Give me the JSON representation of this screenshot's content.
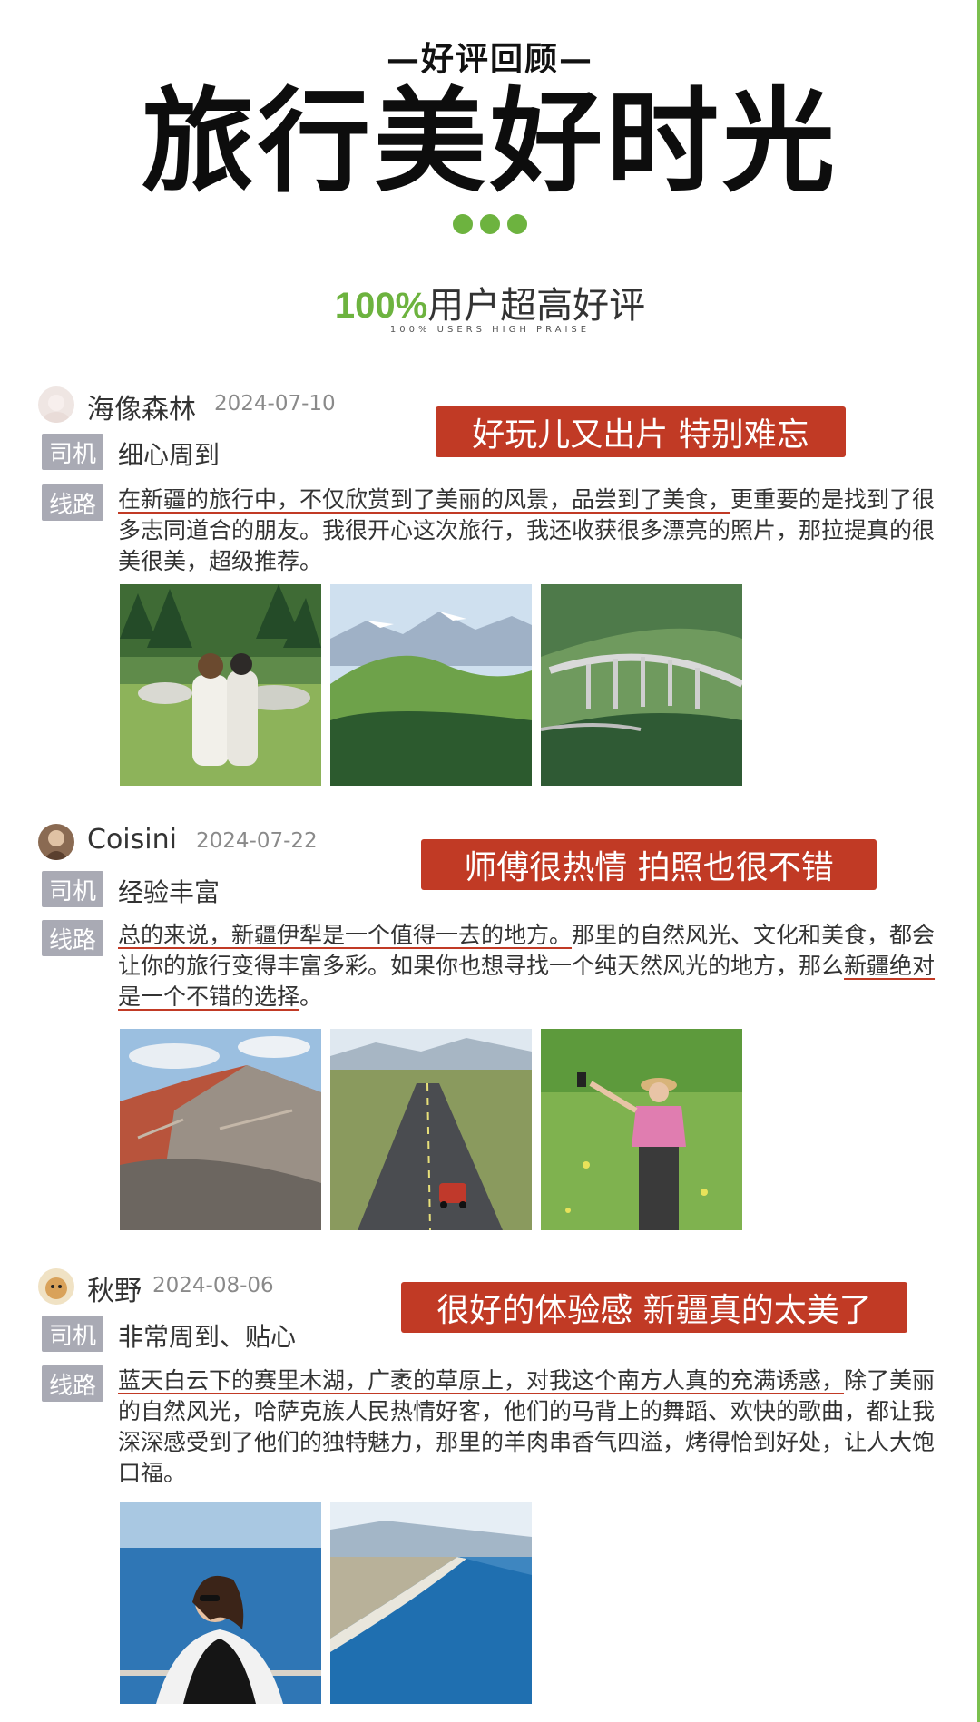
{
  "header": {
    "kicker": "—好评回顾—",
    "title": "旅行美好时光",
    "praise_pct": "100%",
    "praise_text": "用户超高好评",
    "praise_sub": "100% USERS HIGH PRAISE"
  },
  "labels": {
    "driver": "司机",
    "route": "线路"
  },
  "reviews": [
    {
      "name": "海像森林",
      "date": "2024-07-10",
      "highlight": "好玩儿又出片 特别难忘",
      "driver": "细心周到",
      "route_underlined": "在新疆的旅行中，不仅欣赏到了美丽的风景，品尝到了美食，",
      "route_rest": "更重要的是找到了很多志同道合的朋友。我很开心这次旅行，我还收获很多漂亮的照片，那拉提真的很美很美，超级推荐。"
    },
    {
      "name": "Coisini",
      "date": "2024-07-22",
      "highlight": "师傅很热情 拍照也很不错",
      "driver": "经验丰富",
      "route_underlined": "总的来说，新疆伊犁是一个值得一去的地方。",
      "route_mid": "那里的自然风光、文化和美食，都会让你的旅行变得丰富多彩。如果你也想寻找一个纯天然风光的地方，那么",
      "route_underlined2": "新疆绝对是一个不错的选择",
      "route_end": "。"
    },
    {
      "name": "秋野",
      "date": "2024-08-06",
      "highlight": "很好的体验感 新疆真的太美了",
      "driver": "非常周到、贴心",
      "route_underlined": "蓝天白云下的赛里木湖，广袤的草原上，对我这个南方人真的充满诱惑，",
      "route_rest": "除了美丽的自然风光，哈萨克族人民热情好客，他们的马背上的舞蹈、欢快的歌曲，都让我深深感受到了他们的独特魅力，那里的羊肉串香气四溢，烤得恰到好处，让人大饱口福。"
    }
  ],
  "colors": {
    "accent_green": "#6db33f",
    "highlight_red": "#c13a25",
    "tag_gray": "#a9aab4"
  }
}
